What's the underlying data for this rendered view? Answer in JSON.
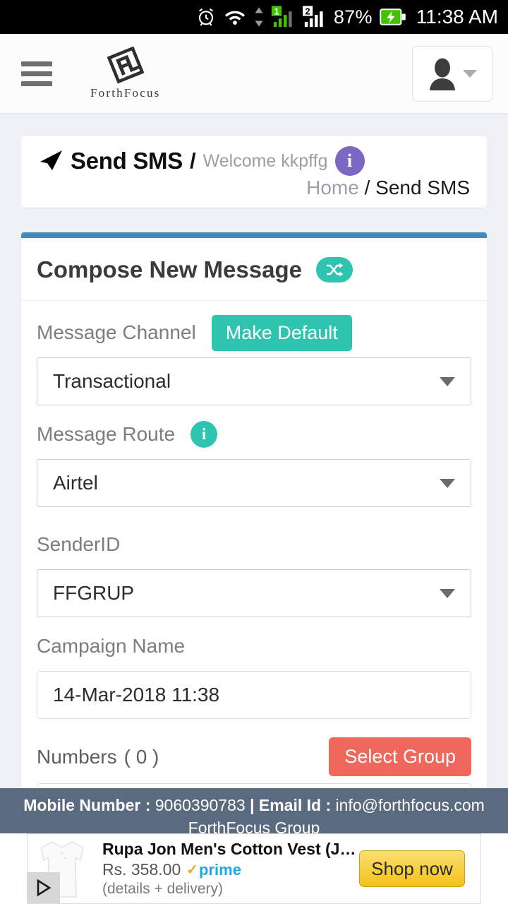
{
  "status_bar": {
    "battery_percent": "87%",
    "time": "11:38 AM",
    "sim1_label": "1",
    "sim2_label": "2",
    "icons": [
      "alarm-icon",
      "wifi-icon",
      "data-transfer-icon",
      "sim1-signal-icon",
      "sim2-signal-icon",
      "battery-charging-icon"
    ]
  },
  "header": {
    "menu_icon": "hamburger-menu-icon",
    "brand_name": "ForthFocus",
    "brand_mark": "forthfocus-logo-icon",
    "avatar_icon": "user-avatar-icon",
    "caret_icon": "chevron-down-icon"
  },
  "page_header": {
    "icon": "paper-plane-icon",
    "title": "Send SMS",
    "separator": "/",
    "welcome": "Welcome kkpffg",
    "info_badge": "i",
    "info_badge_color": "#7b68c4",
    "breadcrumb_home": "Home",
    "breadcrumb_sep": "/",
    "breadcrumb_current": "Send SMS"
  },
  "compose": {
    "title": "Compose New Message",
    "shuffle_badge_icon": "shuffle-icon",
    "accent_color": "#2ec4b0",
    "card_top_border_color": "#3c8dbc",
    "channel": {
      "label": "Message Channel",
      "make_default_label": "Make Default",
      "value": "Transactional"
    },
    "route": {
      "label": "Message Route",
      "info_badge": "i",
      "info_badge_color": "#2ec4b0",
      "value": "Airtel"
    },
    "sender_id": {
      "label": "SenderID",
      "value": "FFGRUP"
    },
    "campaign_name": {
      "label": "Campaign Name",
      "value": "14-Mar-2018 11:38",
      "placeholder": "Campaign Name"
    },
    "numbers": {
      "label": "Numbers",
      "count": "( 0 )",
      "select_group_label": "Select Group",
      "select_group_color": "#f0675c",
      "value": "",
      "placeholder": ""
    }
  },
  "footer": {
    "mobile_label": "Mobile Number :",
    "mobile_value": "9060390783",
    "divider": "|",
    "email_label": "Email Id :",
    "email_value": "info@forthfocus.com",
    "company": "ForthFocus Group",
    "background": "#5a6b80"
  },
  "ad": {
    "product_image": "white-vest-product-image",
    "title": "Rupa Jon Men's Cotton Vest (J…",
    "price": "Rs. 358.00",
    "prime_tick": "✓",
    "prime_label": "prime",
    "details": "(details + delivery)",
    "cta_label": "Shop now",
    "adchoices_icon": "adchoices-icon"
  }
}
